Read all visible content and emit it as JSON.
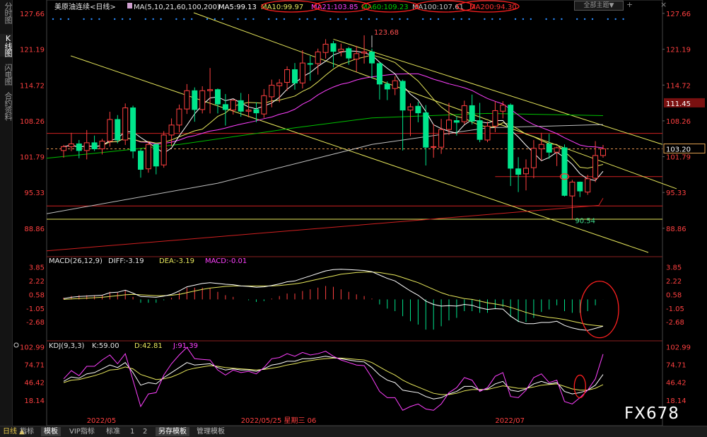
{
  "sidebar": {
    "items": [
      "分时图",
      "K线图",
      "闪电图",
      "合约资料"
    ]
  },
  "header": {
    "title": "美原油连续<日线>",
    "ma_params": "MA(5,10,21,60,100,200)",
    "ma5": "MA5:99.13",
    "ma10": "MA10:99.97",
    "ma21": "MA21:103.85",
    "ma60": "MA60:109.23",
    "ma100": "MA100:107.61",
    "ma200": "MA200:94.30",
    "theme_button": "全部主题",
    "theme_arrow": "▼",
    "icon_plus": "+",
    "icon_close": "×"
  },
  "macd": {
    "title": "MACD(26,12,9)",
    "diff": "DIFF:-3.19",
    "dea": "DEA:-3.19",
    "macd": "MACD:-0.01"
  },
  "kdj": {
    "title": "KDJ(9,3,3)",
    "k": "K:59.00",
    "d": "D:42.81",
    "j": "J:91.39"
  },
  "bottom": {
    "period": "日线 ▲",
    "tabs": [
      "指标",
      "模板",
      "VIP指标",
      "标准",
      "1",
      "2",
      "另存模板",
      "管理模板"
    ]
  },
  "watermark": "FX678",
  "colors": {
    "up": "#ff4040",
    "down": "#00e58c",
    "ma5": "#ffffff",
    "ma10": "#e8e85c",
    "ma21": "#ff40ff",
    "ma60": "#00c000",
    "ma100": "#bfbfbf",
    "ma200": "#d02020"
  },
  "chart_data": {
    "type": "candlestick",
    "instrument": "美原油连续",
    "period": "日线",
    "x_tick_labels": [
      "2022/05",
      "2022/05/25 星期三 06",
      "2022/07"
    ],
    "main_y_ticks": [
      127.66,
      121.19,
      114.72,
      108.26,
      101.79,
      95.33,
      88.86
    ],
    "main_ylim": [
      84.5,
      128.8
    ],
    "candles": [
      [
        102.9,
        103.9,
        101.6,
        103.6
      ],
      [
        103.6,
        106.1,
        102.8,
        104.1
      ],
      [
        104.1,
        104.8,
        101.5,
        102.9
      ],
      [
        102.9,
        106.6,
        101.3,
        104.3
      ],
      [
        104.3,
        105.6,
        102.8,
        103.2
      ],
      [
        103.2,
        105.0,
        102.2,
        104.6
      ],
      [
        104.6,
        109.9,
        103.6,
        108.5
      ],
      [
        108.5,
        109.3,
        104.2,
        104.8
      ],
      [
        104.8,
        111.4,
        103.9,
        110.6
      ],
      [
        110.6,
        111.0,
        101.5,
        102.8
      ],
      [
        102.8,
        103.1,
        98.0,
        99.5
      ],
      [
        99.6,
        104.6,
        98.9,
        104.0
      ],
      [
        104.0,
        104.1,
        98.6,
        100.1
      ],
      [
        100.3,
        106.4,
        99.8,
        105.7
      ],
      [
        105.7,
        108.7,
        103.7,
        107.5
      ],
      [
        107.5,
        111.2,
        106.2,
        110.4
      ],
      [
        110.4,
        114.9,
        109.5,
        113.7
      ],
      [
        113.7,
        114.3,
        108.1,
        110.3
      ],
      [
        110.3,
        114.5,
        109.6,
        113.7
      ],
      [
        113.7,
        117.8,
        109.6,
        113.9
      ],
      [
        113.9,
        114.1,
        109.6,
        111.3
      ],
      [
        111.2,
        113.1,
        107.4,
        110.3
      ],
      [
        110.2,
        112.1,
        109.4,
        112.0
      ],
      [
        111.9,
        113.3,
        109.0,
        110.0
      ],
      [
        110.0,
        113.1,
        108.9,
        110.2
      ],
      [
        110.3,
        111.6,
        108.0,
        109.7
      ],
      [
        109.5,
        114.0,
        108.8,
        112.8
      ],
      [
        112.6,
        115.7,
        110.7,
        114.7
      ],
      [
        114.6,
        115.8,
        111.6,
        115.1
      ],
      [
        115.2,
        118.1,
        113.7,
        117.5
      ],
      [
        117.5,
        118.7,
        113.9,
        115.1
      ],
      [
        115.1,
        121.0,
        114.1,
        118.7
      ],
      [
        118.6,
        120.0,
        115.5,
        118.5
      ],
      [
        118.6,
        121.3,
        116.6,
        120.7
      ],
      [
        120.6,
        123.0,
        119.5,
        122.1
      ],
      [
        122.2,
        122.7,
        117.9,
        120.8
      ],
      [
        120.8,
        122.2,
        119.9,
        121.2
      ],
      [
        121.3,
        121.6,
        118.4,
        119.6
      ],
      [
        119.4,
        121.8,
        117.1,
        120.4
      ],
      [
        120.5,
        123.7,
        118.6,
        120.7
      ],
      [
        120.7,
        121.3,
        115.9,
        118.7
      ],
      [
        118.6,
        118.9,
        112.1,
        114.9
      ],
      [
        114.9,
        115.4,
        112.0,
        114.0
      ],
      [
        114.1,
        116.3,
        112.9,
        115.5
      ],
      [
        115.4,
        115.7,
        102.9,
        110.2
      ],
      [
        110.2,
        111.4,
        105.5,
        110.8
      ],
      [
        110.9,
        111.7,
        108.0,
        109.7
      ],
      [
        109.7,
        111.1,
        100.2,
        103.5
      ],
      [
        103.5,
        107.7,
        101.6,
        103.6
      ],
      [
        103.5,
        108.6,
        102.3,
        106.7
      ],
      [
        106.7,
        111.5,
        105.7,
        108.4
      ],
      [
        108.3,
        109.1,
        105.6,
        108.0
      ],
      [
        108.1,
        111.9,
        107.6,
        111.0
      ],
      [
        111.0,
        113.0,
        107.6,
        108.2
      ],
      [
        108.3,
        111.5,
        104.4,
        104.9
      ],
      [
        104.8,
        108.1,
        104.4,
        107.3
      ],
      [
        107.3,
        111.8,
        106.2,
        110.1
      ],
      [
        110.0,
        111.8,
        108.7,
        111.1
      ],
      [
        111.1,
        111.4,
        96.5,
        99.7
      ],
      [
        99.6,
        101.7,
        95.4,
        98.6
      ],
      [
        98.7,
        101.3,
        95.7,
        99.7
      ],
      [
        99.8,
        104.8,
        97.9,
        103.3
      ],
      [
        103.2,
        106.1,
        101.1,
        104.0
      ],
      [
        104.1,
        105.9,
        101.4,
        102.6
      ],
      [
        102.6,
        103.6,
        100.1,
        103.4
      ],
      [
        103.4,
        104.0,
        94.6,
        94.8
      ],
      [
        94.7,
        97.6,
        90.5,
        97.2
      ],
      [
        97.2,
        97.3,
        94.5,
        95.6
      ],
      [
        95.4,
        98.5,
        94.9,
        97.8
      ],
      [
        97.9,
        104.6,
        97.2,
        102.0
      ],
      [
        102.0,
        103.9,
        101.6,
        103.2
      ]
    ],
    "series": [
      {
        "name": "MA5",
        "value": "99.13"
      },
      {
        "name": "MA10",
        "value": "99.97"
      },
      {
        "name": "MA21",
        "value": "103.85"
      },
      {
        "name": "MA60",
        "value": "109.23"
      },
      {
        "name": "MA100",
        "value": "107.61"
      },
      {
        "name": "MA200",
        "value": "94.30"
      }
    ],
    "price_tags": [
      {
        "value": 111.45,
        "color": "red-tag"
      },
      {
        "value": 103.2,
        "color": "current"
      }
    ],
    "annotations": [
      {
        "text": "123.68",
        "value": 123.68
      },
      {
        "text": "90.54",
        "value": 90.54
      }
    ],
    "horizontal_levels": [
      106.0,
      103.2,
      98.2,
      92.9,
      90.5
    ],
    "macd_y_ticks": [
      3.85,
      2.22,
      0.58,
      -1.05,
      -2.68
    ],
    "macd_ylim": [
      -4.6,
      4.5
    ],
    "macd_diff": [
      0.1,
      0.25,
      0.35,
      0.4,
      0.45,
      0.5,
      0.8,
      0.85,
      1.1,
      0.75,
      0.35,
      0.3,
      0.25,
      0.4,
      0.6,
      1.0,
      1.5,
      1.7,
      1.9,
      2.0,
      1.9,
      1.8,
      1.75,
      1.6,
      1.55,
      1.45,
      1.5,
      1.65,
      1.85,
      2.1,
      2.2,
      2.5,
      2.8,
      3.1,
      3.4,
      3.55,
      3.6,
      3.55,
      3.5,
      3.45,
      3.3,
      2.9,
      2.5,
      2.2,
      1.6,
      1.0,
      0.5,
      -0.2,
      -0.6,
      -0.8,
      -0.75,
      -0.8,
      -0.6,
      -0.7,
      -1.0,
      -1.2,
      -1.1,
      -1.15,
      -2.0,
      -2.6,
      -2.9,
      -2.9,
      -2.75,
      -2.75,
      -2.6,
      -3.1,
      -3.4,
      -3.6,
      -3.7,
      -3.45,
      -3.19
    ],
    "macd_dea": [
      0.0,
      0.05,
      0.1,
      0.15,
      0.2,
      0.25,
      0.35,
      0.45,
      0.55,
      0.6,
      0.55,
      0.5,
      0.45,
      0.45,
      0.5,
      0.6,
      0.8,
      1.0,
      1.2,
      1.35,
      1.45,
      1.55,
      1.6,
      1.6,
      1.6,
      1.6,
      1.6,
      1.6,
      1.65,
      1.75,
      1.85,
      2.0,
      2.2,
      2.4,
      2.6,
      2.8,
      3.0,
      3.1,
      3.2,
      3.25,
      3.25,
      3.2,
      3.05,
      2.9,
      2.6,
      2.3,
      2.0,
      1.6,
      1.2,
      0.8,
      0.5,
      0.3,
      0.1,
      0.0,
      -0.2,
      -0.4,
      -0.55,
      -0.7,
      -0.95,
      -1.25,
      -1.55,
      -1.8,
      -2.0,
      -2.15,
      -2.25,
      -2.4,
      -2.6,
      -2.8,
      -3.0,
      -3.1,
      -3.19
    ],
    "macd_hist": [
      0.2,
      0.4,
      0.5,
      0.5,
      0.5,
      0.5,
      0.9,
      0.8,
      1.1,
      0.3,
      -0.4,
      -0.4,
      -0.4,
      -0.1,
      0.2,
      0.8,
      1.4,
      1.4,
      1.4,
      1.3,
      0.9,
      0.5,
      0.3,
      0.0,
      -0.1,
      -0.3,
      -0.2,
      0.1,
      0.4,
      0.7,
      0.7,
      1.0,
      1.2,
      1.4,
      1.6,
      1.5,
      1.2,
      0.9,
      0.6,
      0.4,
      0.1,
      -0.6,
      -1.1,
      -1.4,
      -2.0,
      -2.6,
      -3.0,
      -3.6,
      -3.6,
      -3.2,
      -2.5,
      -2.2,
      -1.4,
      -1.4,
      -1.6,
      -1.6,
      -1.1,
      -0.9,
      -2.1,
      -2.7,
      -2.7,
      -2.2,
      -1.5,
      -1.2,
      -0.7,
      -1.4,
      -1.6,
      -1.6,
      -1.4,
      -0.7,
      -0.01
    ],
    "kdj_y_ticks": [
      102.99,
      74.71,
      46.42,
      18.14
    ],
    "kdj_ylim": [
      0,
      108
    ],
    "kdj_k": [
      48,
      55,
      53,
      60,
      62,
      68,
      74,
      70,
      78,
      62,
      42,
      46,
      44,
      54,
      62,
      70,
      78,
      74,
      75,
      76,
      70,
      66,
      68,
      66,
      66,
      64,
      68,
      74,
      76,
      80,
      80,
      84,
      84,
      86,
      88,
      86,
      84,
      82,
      80,
      79,
      70,
      58,
      50,
      46,
      34,
      32,
      30,
      24,
      20,
      22,
      28,
      32,
      40,
      40,
      34,
      36,
      44,
      48,
      34,
      32,
      36,
      44,
      48,
      44,
      46,
      32,
      28,
      30,
      34,
      42,
      59
    ],
    "kdj_d": [
      46,
      50,
      51,
      54,
      57,
      61,
      66,
      67,
      71,
      68,
      59,
      55,
      51,
      52,
      55,
      60,
      66,
      69,
      71,
      73,
      72,
      70,
      69,
      68,
      67,
      66,
      67,
      69,
      71,
      74,
      76,
      79,
      81,
      83,
      84,
      85,
      85,
      84,
      83,
      82,
      78,
      71,
      64,
      58,
      50,
      44,
      39,
      34,
      29,
      27,
      27,
      29,
      33,
      35,
      35,
      35,
      38,
      41,
      39,
      37,
      37,
      39,
      42,
      43,
      44,
      40,
      36,
      34,
      34,
      37,
      42.81
    ],
    "kdj_j": [
      52,
      65,
      57,
      72,
      72,
      82,
      90,
      76,
      92,
      50,
      8,
      28,
      30,
      58,
      76,
      90,
      102,
      84,
      83,
      82,
      66,
      58,
      66,
      62,
      64,
      60,
      70,
      84,
      86,
      92,
      88,
      94,
      90,
      92,
      96,
      88,
      82,
      78,
      74,
      73,
      54,
      32,
      22,
      22,
      2,
      8,
      12,
      4,
      2,
      12,
      30,
      38,
      54,
      50,
      32,
      38,
      56,
      62,
      24,
      22,
      34,
      54,
      60,
      46,
      50,
      16,
      12,
      22,
      34,
      52,
      91.39
    ]
  }
}
